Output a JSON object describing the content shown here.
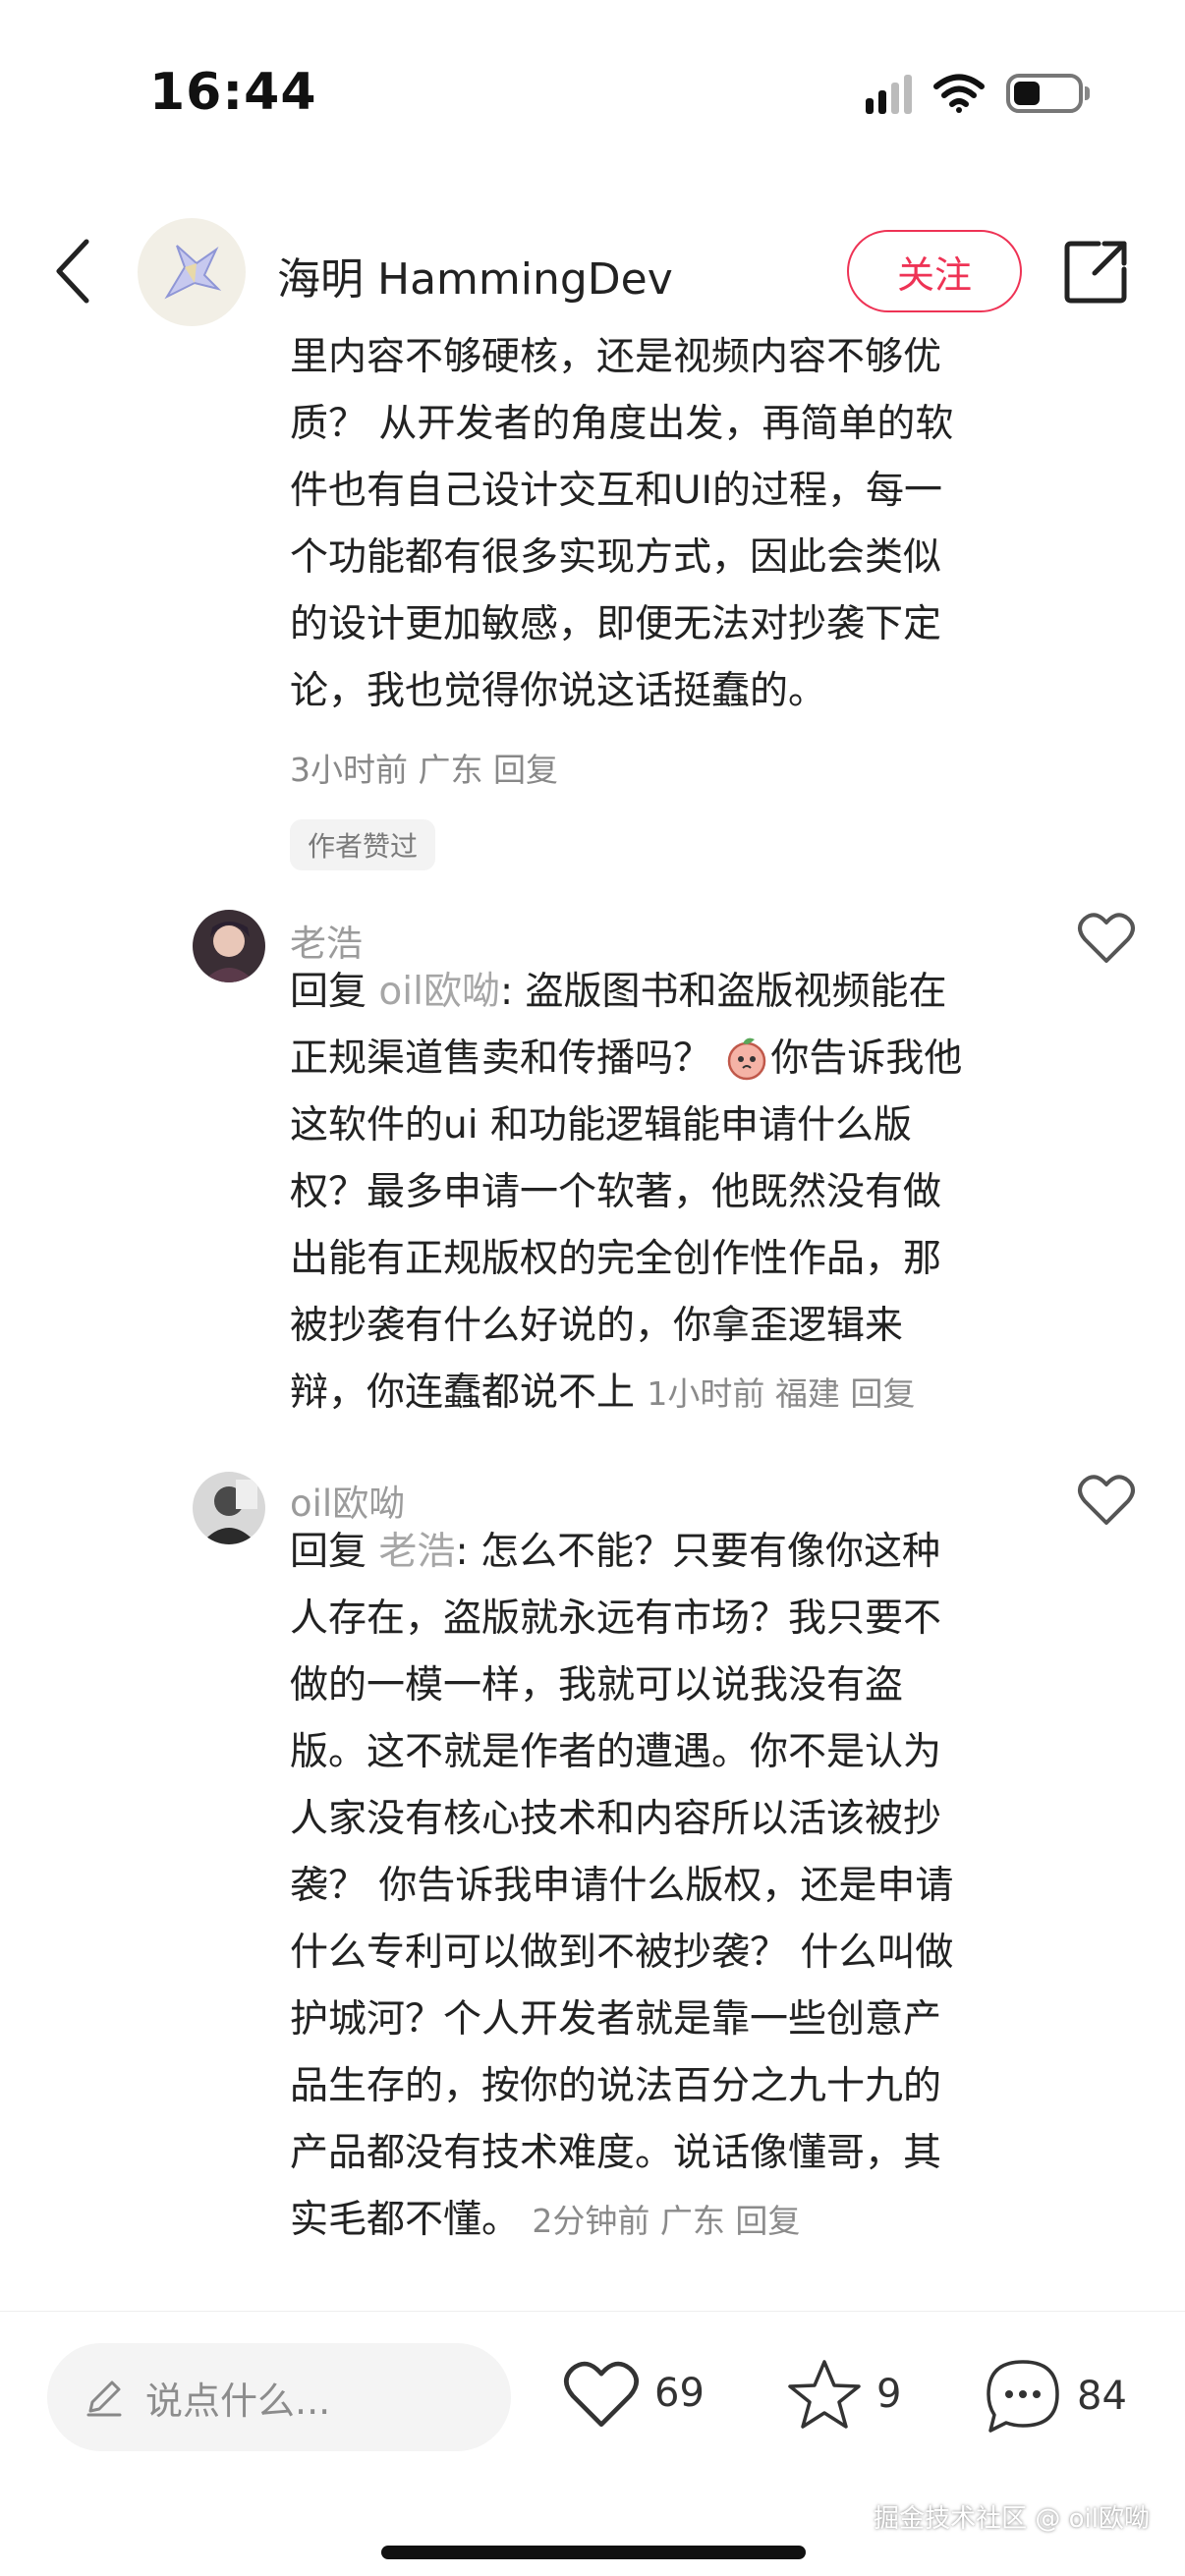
{
  "status_bar": {
    "time": "16:44"
  },
  "header": {
    "author_name": "海明 HammingDev",
    "follow_label": "关注"
  },
  "main_comment": {
    "lines": [
      "里内容不够硬核，还是视频内容不够优",
      "质？ 从开发者的角度出发，再简单的软",
      "件也有自己设计交互和UI的过程，每一",
      "个功能都有很多实现方式，因此会类似",
      "的设计更加敏感，即便无法对抄袭下定",
      "论，我也觉得你说这话挺蠢的。"
    ],
    "meta": "3小时前 广东 回复",
    "badge": "作者赞过"
  },
  "replies": [
    {
      "user": "老浩",
      "reply_prefix": "回复",
      "reply_to": "oil欧呦",
      "lines": [
        "盗版图书和盗版视频能在",
        "正规渠道售卖和传播吗？",
        "你告诉我他",
        "这软件的ui 和功能逻辑能申请什么版",
        "权？最多申请一个软著，他既然没有做",
        "出能有正规版权的完全创作性作品，那",
        "被抄袭有什么好说的，你拿歪逻辑来",
        "辩，你连蠢都说不上"
      ],
      "meta": "1小时前 福建 回复"
    },
    {
      "user": "oil欧呦",
      "reply_prefix": "回复",
      "reply_to": "老浩",
      "lines": [
        "怎么不能？只要有像你这种",
        "人存在，盗版就永远有市场？我只要不",
        "做的一模一样，我就可以说我没有盗",
        "版。这不就是作者的遭遇。你不是认为",
        "人家没有核心技术和内容所以活该被抄",
        "袭？ 你告诉我申请什么版权，还是申请",
        "什么专利可以做到不被抄袭？ 什么叫做",
        "护城河？个人开发者就是靠一些创意产",
        "品生存的，按你的说法百分之九十九的",
        "产品都没有技术难度。说话像懂哥，其",
        "实毛都不懂。"
      ],
      "meta": "2分钟前 广东 回复"
    }
  ],
  "bottom_bar": {
    "input_placeholder": "说点什么...",
    "likes": "69",
    "favorites": "9",
    "comments": "84",
    "watermark": "掘金技术社区 @ oil欧呦"
  },
  "colors": {
    "accent": "#ee3355",
    "meta_gray": "#8a8a8a"
  },
  "icons": [
    "back-icon",
    "share-icon",
    "heart-icon",
    "star-icon",
    "comment-icon",
    "pencil-icon",
    "signal-icon",
    "wifi-icon",
    "battery-icon",
    "peach-emoji-icon"
  ]
}
